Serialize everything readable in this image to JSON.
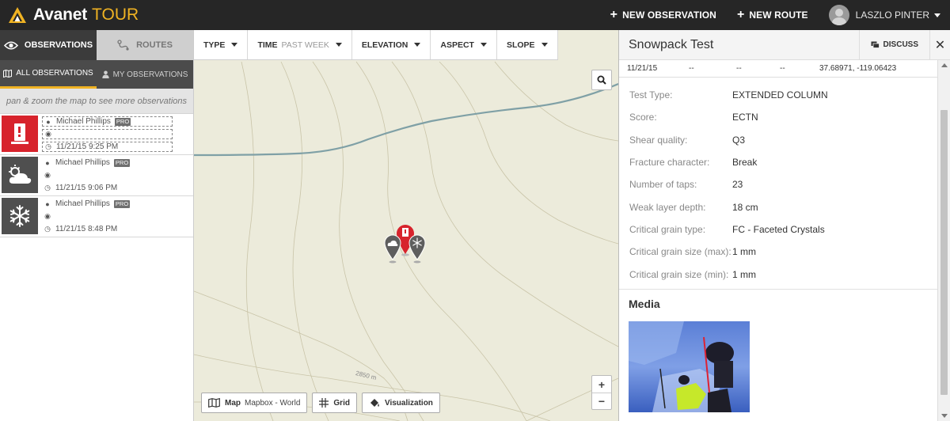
{
  "app": {
    "brand_name": "Avanet",
    "brand_suffix": "TOUR"
  },
  "topbar": {
    "new_observation": "NEW OBSERVATION",
    "new_route": "NEW ROUTE",
    "user_name": "LASZLO PINTER"
  },
  "left": {
    "tabs": [
      {
        "label": "OBSERVATIONS",
        "active": true
      },
      {
        "label": "ROUTES",
        "active": false
      }
    ],
    "subtabs": [
      {
        "label": "ALL OBSERVATIONS",
        "active": true
      },
      {
        "label": "MY OBSERVATIONS",
        "active": false
      }
    ],
    "hint": "pan & zoom the map to see more observations",
    "observations": [
      {
        "icon": "snowpack-test-icon",
        "author": "Michael Phillips",
        "badge": "PRO",
        "group": "",
        "time": "11/21/15 9:25 PM",
        "color": "#d7232c"
      },
      {
        "icon": "cloud-weather-icon",
        "author": "Michael Phillips",
        "badge": "PRO",
        "group": "",
        "time": "11/21/15 9:06 PM",
        "color": "#4f4f4f"
      },
      {
        "icon": "snowflake-icon",
        "author": "Michael Phillips",
        "badge": "PRO",
        "group": "",
        "time": "11/21/15 8:48 PM",
        "color": "#4f4f4f"
      }
    ]
  },
  "map": {
    "filters": [
      {
        "label": "TYPE",
        "sub": ""
      },
      {
        "label": "TIME",
        "sub": "PAST WEEK"
      },
      {
        "label": "ELEVATION",
        "sub": ""
      },
      {
        "label": "ASPECT",
        "sub": ""
      },
      {
        "label": "SLOPE",
        "sub": ""
      }
    ],
    "contour_label": "2850 m",
    "zoom_in": "+",
    "zoom_out": "−",
    "controls": {
      "map_label": "Map",
      "map_source": "Mapbox - World",
      "grid_label": "Grid",
      "viz_label": "Visualization"
    }
  },
  "detail": {
    "title": "Snowpack Test",
    "discuss": "DISCUSS",
    "close": "✕",
    "summary": {
      "date": "11/21/15",
      "c2": "--",
      "c3": "--",
      "c4": "--",
      "coords": "37.68971, -119.06423"
    },
    "fields": [
      {
        "label": "Test Type:",
        "value": "EXTENDED COLUMN"
      },
      {
        "label": "Score:",
        "value": "ECTN"
      },
      {
        "label": "Shear quality:",
        "value": "Q3"
      },
      {
        "label": "Fracture character:",
        "value": "Break"
      },
      {
        "label": "Number of taps:",
        "value": "23"
      },
      {
        "label": "Weak layer depth:",
        "value": "18 cm"
      },
      {
        "label": "Critical grain type:",
        "value": "FC - Faceted Crystals"
      },
      {
        "label": "Critical grain size (max):",
        "value": "1 mm"
      },
      {
        "label": "Critical grain size (min):",
        "value": "1 mm"
      }
    ],
    "media_title": "Media"
  },
  "colors": {
    "accent": "#f0b323",
    "topbar": "#262626",
    "red": "#d7232c",
    "map_bg": "#ecebdb",
    "river": "#7fa0a6"
  }
}
